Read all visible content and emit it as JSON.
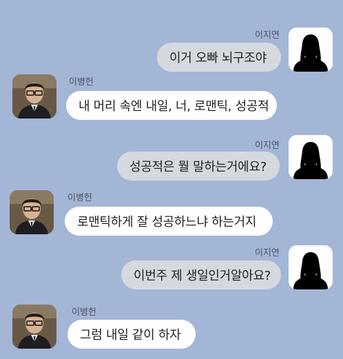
{
  "messages": [
    {
      "side": "right",
      "sender": "이지연",
      "text": "이거 오빠 뇌구조야"
    },
    {
      "side": "left",
      "sender": "이병헌",
      "text": "내 머리 속엔 내일, 너, 로맨틱, 성공적"
    },
    {
      "side": "right",
      "sender": "이지연",
      "text": "성공적은 뭘 말하는거에요?"
    },
    {
      "side": "left",
      "sender": "이병헌",
      "text": "로맨틱하게 잘 성공하느냐 하는거지"
    },
    {
      "side": "right",
      "sender": "이지연",
      "text": "이번주 제 생일인거알아요?"
    },
    {
      "side": "left",
      "sender": "이병헌",
      "text": "그럼 내일 같이 하자"
    }
  ],
  "colors": {
    "background": "#a4b6d6",
    "my_bubble": "#d5d9df",
    "other_bubble": "#ffffff"
  }
}
